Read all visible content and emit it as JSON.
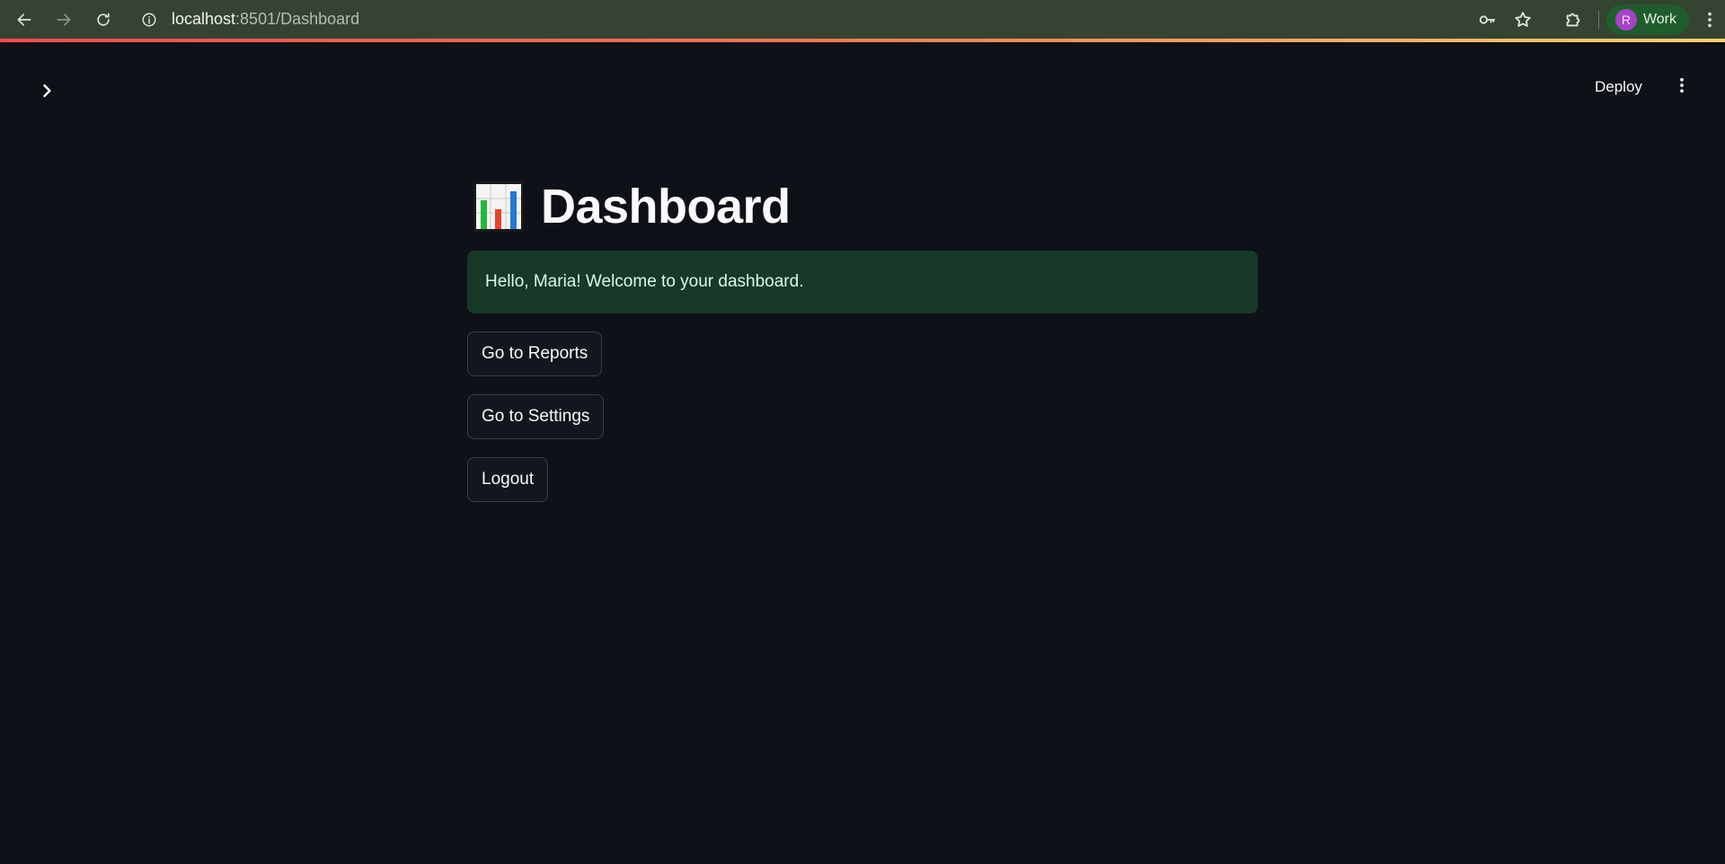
{
  "browser": {
    "url_host": "localhost",
    "url_path": ":8501/Dashboard",
    "profile": {
      "initial": "R",
      "label": "Work",
      "avatar_color": "#a542c9"
    },
    "icons": [
      "back-icon",
      "forward-icon",
      "reload-icon",
      "info-icon",
      "key-icon",
      "star-icon",
      "extensions-icon",
      "kebab-menu-icon"
    ]
  },
  "app": {
    "header": {
      "deploy_label": "Deploy"
    },
    "main": {
      "title": "Dashboard",
      "title_icon": "bar-chart-emoji",
      "success_message": "Hello, Maria! Welcome to your dashboard.",
      "buttons": [
        {
          "label": "Go to Reports"
        },
        {
          "label": "Go to Settings"
        },
        {
          "label": "Logout"
        }
      ]
    }
  },
  "colors": {
    "app_background": "#0e1117",
    "browser_toolbar": "#354333",
    "success_background": "#173928",
    "success_text": "#dff7e5",
    "accent_gradient_start": "#ff4b4b",
    "accent_gradient_end": "#ffd16a"
  }
}
